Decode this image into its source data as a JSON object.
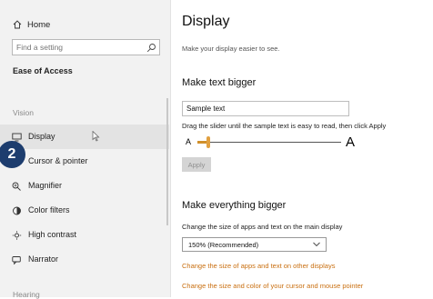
{
  "sidebar": {
    "home_label": "Home",
    "search_placeholder": "Find a setting",
    "section_title": "Ease of Access",
    "vision_label": "Vision",
    "items": [
      {
        "label": "Display",
        "icon": "monitor-icon",
        "active": true
      },
      {
        "label": "Cursor & pointer",
        "icon": "cursor-pointer-icon"
      },
      {
        "label": "Magnifier",
        "icon": "magnifier-icon"
      },
      {
        "label": "Color filters",
        "icon": "color-filters-icon"
      },
      {
        "label": "High contrast",
        "icon": "high-contrast-icon"
      },
      {
        "label": "Narrator",
        "icon": "narrator-icon"
      }
    ],
    "hearing_label": "Hearing"
  },
  "badge": "2",
  "main": {
    "title": "Display",
    "subtitle": "Make your display easier to see.",
    "text_bigger": {
      "heading": "Make text bigger",
      "sample": "Sample text",
      "hint": "Drag the slider until the sample text is easy to read, then click Apply",
      "small_a": "A",
      "large_a": "A",
      "slider_value_percent": 100,
      "apply_label": "Apply"
    },
    "everything_bigger": {
      "heading": "Make everything bigger",
      "desc": "Change the size of apps and text on the main display",
      "selected_scale": "150% (Recommended)",
      "link1": "Change the size of apps and text on other displays",
      "link2": "Change the size and color of your cursor and mouse pointer"
    }
  },
  "colors": {
    "accent_link": "#c96f10",
    "slider_thumb": "#e1a040",
    "badge": "#1d3d6e"
  }
}
